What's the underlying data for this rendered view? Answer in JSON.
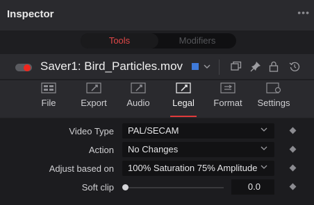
{
  "panel": {
    "title": "Inspector",
    "more": "•••"
  },
  "segmented": {
    "tools": "Tools",
    "modifiers": "Modifiers"
  },
  "tool": {
    "name": "Saver1: Bird_Particles.mov",
    "enabled": true,
    "color": "#3f7ad9"
  },
  "tabs": [
    {
      "label": "File",
      "icon": "file-icon"
    },
    {
      "label": "Export",
      "icon": "export-icon"
    },
    {
      "label": "Audio",
      "icon": "audio-icon"
    },
    {
      "label": "Legal",
      "icon": "legal-icon",
      "active": true
    },
    {
      "label": "Format",
      "icon": "format-icon"
    },
    {
      "label": "Settings",
      "icon": "settings-icon"
    }
  ],
  "controls": {
    "video_type": {
      "label": "Video Type",
      "value": "PAL/SECAM"
    },
    "action": {
      "label": "Action",
      "value": "No Changes"
    },
    "adjust_based_on": {
      "label": "Adjust based on",
      "value": "100% Saturation 75% Amplitude"
    },
    "soft_clip": {
      "label": "Soft clip",
      "value": "0.0",
      "fraction": 0.0
    }
  },
  "accent": "#e03a3a"
}
